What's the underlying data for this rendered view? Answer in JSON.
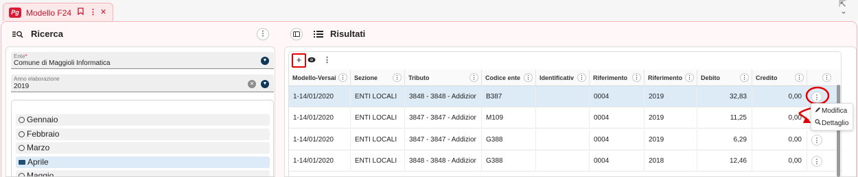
{
  "tab": {
    "logo_text": "Pg",
    "title": "Modello F24",
    "bookmark_icon": "bookmark-icon",
    "menu_icon": "kebab-icon",
    "close_icon": "close-icon"
  },
  "left": {
    "title": "Ricerca",
    "ente": {
      "label": "Ente",
      "required_mark": "*",
      "value": "Comune di Maggioli Informatica"
    },
    "anno": {
      "label": "Anno elaborazione",
      "value": "2019"
    },
    "months": [
      {
        "label": "Gennaio",
        "selected": false
      },
      {
        "label": "Febbraio",
        "selected": false
      },
      {
        "label": "Marzo",
        "selected": false
      },
      {
        "label": "Aprile",
        "selected": true
      },
      {
        "label": "Maggio",
        "selected": false
      }
    ]
  },
  "right": {
    "title": "Risultati",
    "columns": [
      "Modello-Versai",
      "Sezione",
      "Tributo",
      "Codice ente",
      "Identificativ",
      "Riferimento",
      "Riferimento",
      "Debito",
      "Credito"
    ],
    "rows": [
      [
        "1-14/01/2020",
        "ENTI LOCALI",
        "3848 - 3848 - Addizior",
        "B387",
        "",
        "0004",
        "2019",
        "32,83",
        "0,00"
      ],
      [
        "1-14/01/2020",
        "ENTI LOCALI",
        "3847 - 3847 - Addizior",
        "M109",
        "",
        "0004",
        "2019",
        "11,25",
        "0,00"
      ],
      [
        "1-14/01/2020",
        "ENTI LOCALI",
        "3847 - 3847 - Addizior",
        "G388",
        "",
        "0004",
        "2019",
        "6,29",
        "0,00"
      ],
      [
        "1-14/01/2020",
        "ENTI LOCALI",
        "3848 - 3848 - Addizior",
        "G388",
        "",
        "0004",
        "2018",
        "12,46",
        "0,00"
      ]
    ],
    "selected_row": 0,
    "context_menu": [
      {
        "label": "Modifica",
        "icon": "pencil-icon"
      },
      {
        "label": "Dettaglio",
        "icon": "magnifier-icon"
      }
    ]
  },
  "colors": {
    "brand": "#d71c35",
    "annotation": "#e00000",
    "selected_row": "#ddebf6",
    "dropdown": "#0f3756"
  }
}
